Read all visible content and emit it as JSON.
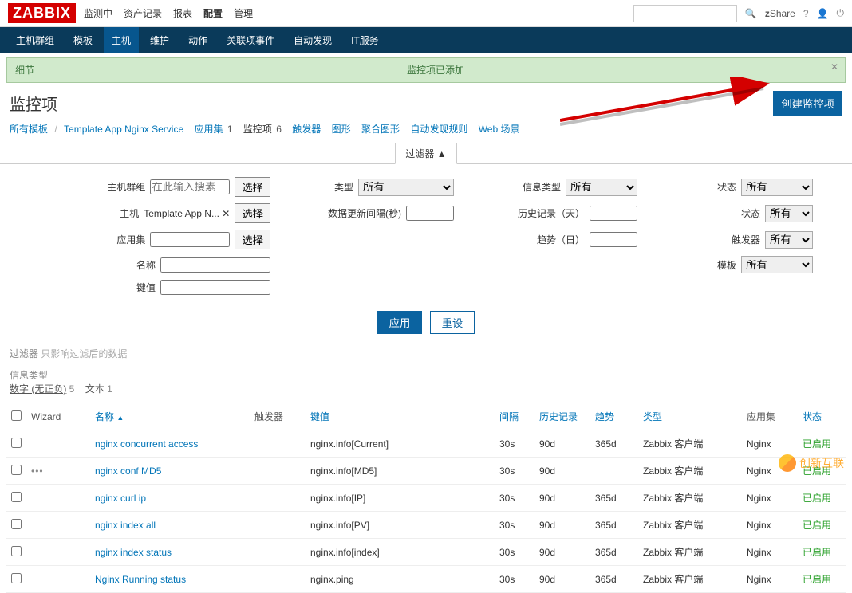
{
  "logo_text": "ZABBIX",
  "topmenu": [
    "监测中",
    "资产记录",
    "报表",
    "配置",
    "管理"
  ],
  "topmenu_active": 3,
  "share_label": "Share",
  "zprefix": "z",
  "search_placeholder": " ",
  "navbar": [
    "主机群组",
    "模板",
    "主机",
    "维护",
    "动作",
    "关联项事件",
    "自动发现",
    "IT服务"
  ],
  "navbar_active": 2,
  "banner_details": "细节",
  "banner_msg": "监控项已添加",
  "page_title": "监控项",
  "create_btn": "创建监控项",
  "crumbs": {
    "all_templates": "所有模板",
    "template_name": "Template App Nginx Service",
    "apps": "应用集",
    "apps_n": "1",
    "items": "监控项",
    "items_n": "6",
    "triggers": "触发器",
    "graphs": "图形",
    "aggr": "聚合图形",
    "discovery": "自动发现规则",
    "web": "Web 场景"
  },
  "filter_toggle": "过滤器 ▲",
  "filters": {
    "hostgroup_label": "主机群组",
    "hostgroup_placeholder": "在此输入搜素",
    "select": "选择",
    "host_label": "主机",
    "host_chip": "Template App N...  ✕",
    "appset_label": "应用集",
    "name_label": "名称",
    "key_label": "键值",
    "type_label": "类型",
    "type_val": "所有",
    "interval_label": "数据更新间隔(秒)",
    "infotype_label": "信息类型",
    "infotype_val": "所有",
    "history_label": "历史记录（天）",
    "trend_label": "趋势（日）",
    "state_label": "状态",
    "state_val": "所有",
    "status_label": "状态",
    "status_val": "所有",
    "trigger_label": "触发器",
    "trigger_val": "所有",
    "template_label": "模板",
    "template_val": "所有",
    "apply": "应用",
    "reset": "重设"
  },
  "filter_note_prefix": "过滤器",
  "filter_note": "只影响过滤后的数据",
  "subfilter_title": "信息类型",
  "subfilter_a": "数字 (无正负)",
  "subfilter_a_n": "5",
  "subfilter_b": "文本",
  "subfilter_b_n": "1",
  "columns": {
    "wizard": "Wizard",
    "name": "名称",
    "triggers": "触发器",
    "key": "键值",
    "interval": "间隔",
    "history": "历史记录",
    "trend": "趋势",
    "type": "类型",
    "appset": "应用集",
    "status": "状态"
  },
  "sort_arrow": "▲",
  "rows": [
    {
      "wiz": "",
      "name": "nginx concurrent access",
      "key": "nginx.info[Current]",
      "interval": "30s",
      "history": "90d",
      "trend": "365d",
      "type": "Zabbix 客户端",
      "appset": "Nginx",
      "status": "已启用"
    },
    {
      "wiz": "•••",
      "name": "nginx conf MD5",
      "key": "nginx.info[MD5]",
      "interval": "30s",
      "history": "90d",
      "trend": "",
      "type": "Zabbix 客户端",
      "appset": "Nginx",
      "status": "已启用"
    },
    {
      "wiz": "",
      "name": "nginx curl ip",
      "key": "nginx.info[IP]",
      "interval": "30s",
      "history": "90d",
      "trend": "365d",
      "type": "Zabbix 客户端",
      "appset": "Nginx",
      "status": "已启用"
    },
    {
      "wiz": "",
      "name": "nginx index all",
      "key": "nginx.info[PV]",
      "interval": "30s",
      "history": "90d",
      "trend": "365d",
      "type": "Zabbix 客户端",
      "appset": "Nginx",
      "status": "已启用"
    },
    {
      "wiz": "",
      "name": "nginx index status",
      "key": "nginx.info[index]",
      "interval": "30s",
      "history": "90d",
      "trend": "365d",
      "type": "Zabbix 客户端",
      "appset": "Nginx",
      "status": "已启用"
    },
    {
      "wiz": "",
      "name": "Nginx Running status",
      "key": "nginx.ping",
      "interval": "30s",
      "history": "90d",
      "trend": "365d",
      "type": "Zabbix 客户端",
      "appset": "Nginx",
      "status": "已启用"
    }
  ],
  "watermark": "创新互联"
}
